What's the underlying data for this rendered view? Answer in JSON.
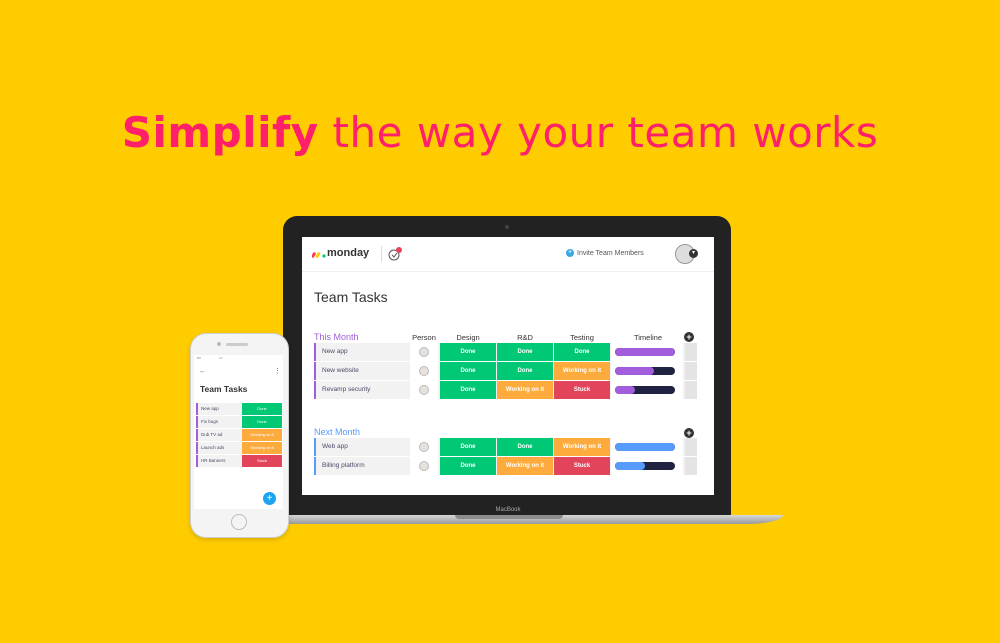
{
  "headline": {
    "bold": "Simplify",
    "rest": "the way your team works"
  },
  "colors": {
    "background": "#ffcc00",
    "headline": "#ff1f6b",
    "done": "#00c875",
    "working": "#fdab3d",
    "stuck": "#e2445c",
    "group_this_month": "#a25ddc",
    "group_next_month": "#579bfc"
  },
  "laptop": {
    "brand_label": "MacBook"
  },
  "app": {
    "logo_text": "monday",
    "invite_label": "Invite Team Members",
    "board_title": "Team Tasks",
    "columns": [
      "Person",
      "Design",
      "R&D",
      "Testing",
      "Timeline"
    ],
    "groups": [
      {
        "title": "This Month",
        "color": "#a25ddc",
        "rows": [
          {
            "name": "New app",
            "design": "Done",
            "rd": "Done",
            "testing": "Done",
            "timeline_fill": 1.0
          },
          {
            "name": "New website",
            "design": "Done",
            "rd": "Done",
            "testing": "Working on it",
            "timeline_fill": 0.65
          },
          {
            "name": "Revamp security",
            "design": "Done",
            "rd": "Working on it",
            "testing": "Stuck",
            "timeline_fill": 0.33
          }
        ]
      },
      {
        "title": "Next Month",
        "color": "#579bfc",
        "rows": [
          {
            "name": "Web app",
            "design": "Done",
            "rd": "Done",
            "testing": "Working on it",
            "timeline_fill": 1.0
          },
          {
            "name": "Billing platform",
            "design": "Done",
            "rd": "Working on it",
            "testing": "Stuck",
            "timeline_fill": 0.5
          }
        ]
      }
    ]
  },
  "phone": {
    "title": "Team Tasks",
    "rows": [
      {
        "name": "New app",
        "status": "Done"
      },
      {
        "name": "Fix bugs",
        "status": "Done"
      },
      {
        "name": "Dub TV ad",
        "status": "Working on it"
      },
      {
        "name": "Launch ads",
        "status": "Working on it"
      },
      {
        "name": "HR Banners",
        "status": "Stuck"
      }
    ]
  }
}
